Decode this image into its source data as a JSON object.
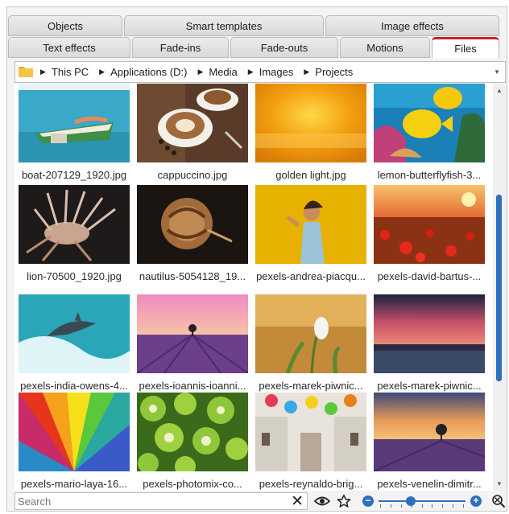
{
  "tabs_top": [
    {
      "label": "Objects"
    },
    {
      "label": "Smart templates"
    },
    {
      "label": "Image effects"
    }
  ],
  "tabs_bottom": [
    {
      "label": "Text effects",
      "active": false
    },
    {
      "label": "Fade-ins",
      "active": false
    },
    {
      "label": "Fade-outs",
      "active": false
    },
    {
      "label": "Motions",
      "active": false
    },
    {
      "label": "Files",
      "active": true
    }
  ],
  "breadcrumb": [
    "This PC",
    "Applications (D:)",
    "Media",
    "Images",
    "Projects"
  ],
  "files": [
    {
      "name": "boat-207129_1920.jpg",
      "thumb": "boat"
    },
    {
      "name": "cappuccino.jpg",
      "thumb": "coffee"
    },
    {
      "name": "golden light.jpg",
      "thumb": "golden"
    },
    {
      "name": "lemon-butterflyfish-3...",
      "thumb": "fish"
    },
    {
      "name": "lion-70500_1920.jpg",
      "thumb": "lionfish"
    },
    {
      "name": "nautilus-5054128_19...",
      "thumb": "nautilus"
    },
    {
      "name": "pexels-andrea-piacqu...",
      "thumb": "yellowwoman"
    },
    {
      "name": "pexels-david-bartus-...",
      "thumb": "poppies"
    },
    {
      "name": "pexels-india-owens-4...",
      "thumb": "dolphin"
    },
    {
      "name": "pexels-ioannis-ioanni...",
      "thumb": "lavender"
    },
    {
      "name": "pexels-marek-piwnic...",
      "thumb": "snowdrop"
    },
    {
      "name": "pexels-marek-piwnic...",
      "thumb": "sunsetsea"
    },
    {
      "name": "pexels-mario-laya-16...",
      "thumb": "umbrella"
    },
    {
      "name": "pexels-photomix-co...",
      "thumb": "kiwi"
    },
    {
      "name": "pexels-reynaldo-brig...",
      "thumb": "street"
    },
    {
      "name": "pexels-venelin-dimitr...",
      "thumb": "lavendertree"
    }
  ],
  "search": {
    "placeholder": "Search",
    "value": ""
  },
  "icons": {
    "folder": "folder-icon",
    "clear": "clear-x-icon",
    "eye": "eye-icon",
    "star": "star-icon",
    "zoom_out": "zoom-out-icon",
    "zoom_in": "zoom-in-icon",
    "zoom_fit": "zoom-fit-icon"
  },
  "zoom": {
    "level": 0.35
  },
  "colors": {
    "accent": "#2d6fbf",
    "active_tab_top": "#c0232c"
  }
}
